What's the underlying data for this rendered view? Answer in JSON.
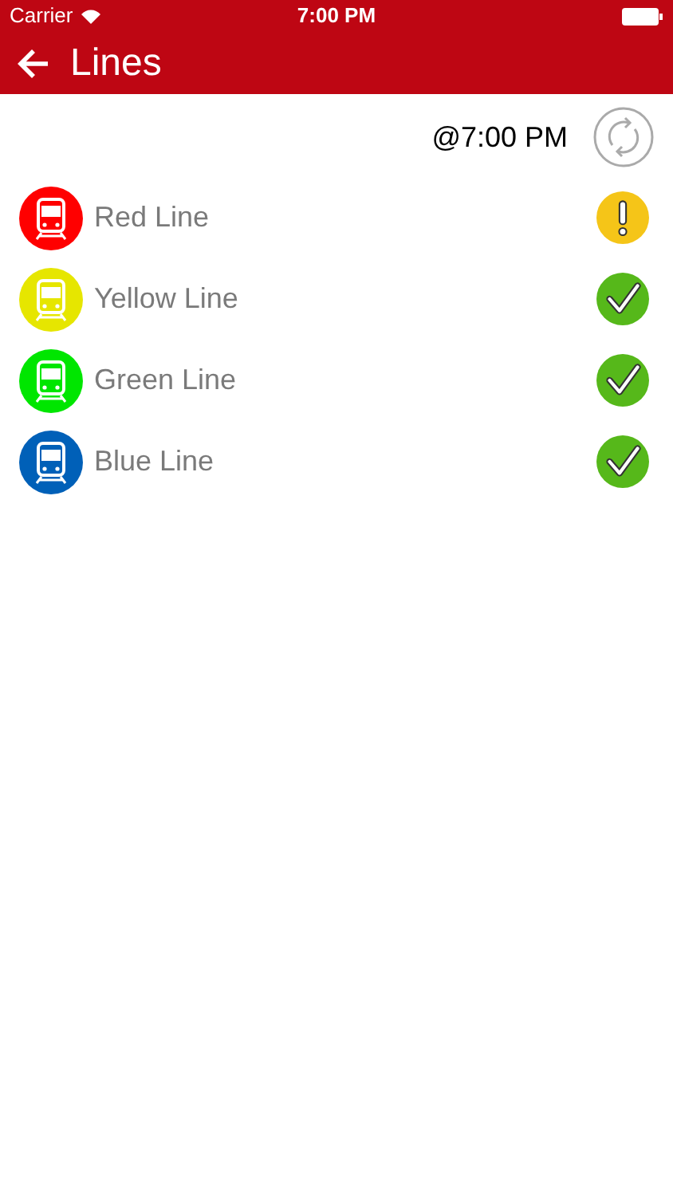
{
  "status_bar": {
    "carrier": "Carrier",
    "time": "7:00 PM"
  },
  "nav": {
    "title": "Lines"
  },
  "updated": "@7:00 PM",
  "lines": [
    {
      "name": "Red Line",
      "color": "#ff0000",
      "kind": "warning"
    },
    {
      "name": "Yellow Line",
      "color": "#e6e600",
      "kind": "ok"
    },
    {
      "name": "Green Line",
      "color": "#00e600",
      "kind": "ok"
    },
    {
      "name": "Blue Line",
      "color": "#0060b8",
      "kind": "ok"
    }
  ]
}
